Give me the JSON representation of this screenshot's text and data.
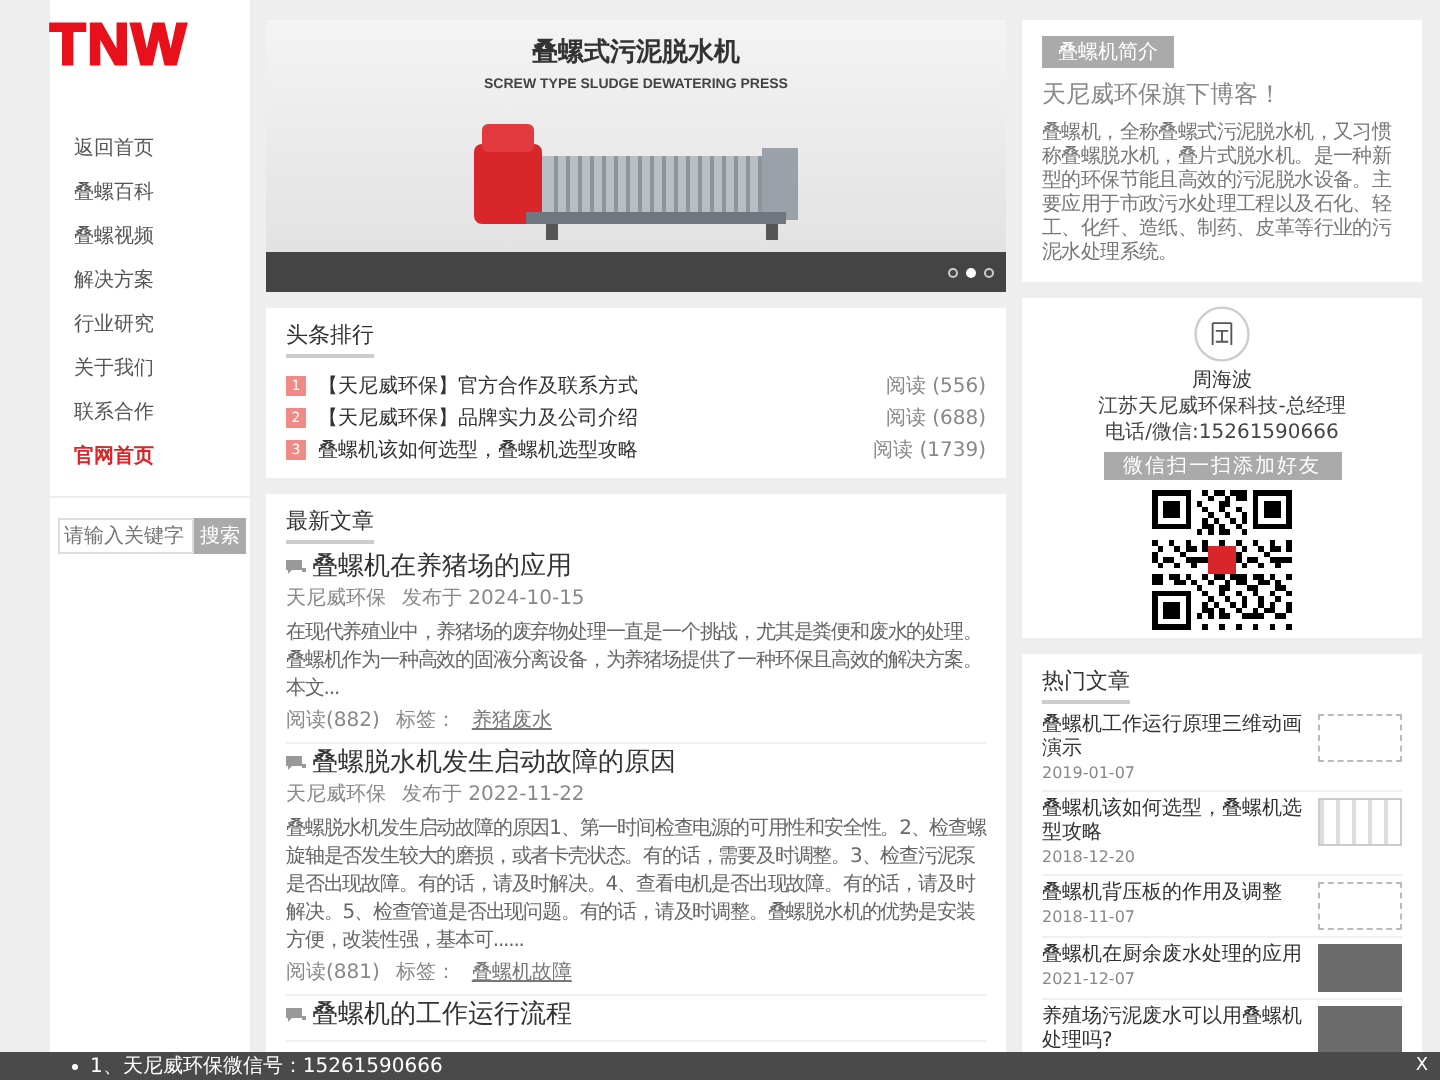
{
  "logo": "TNW",
  "nav": [
    {
      "label": "返回首页",
      "emphasized": false
    },
    {
      "label": "叠螺百科",
      "emphasized": false
    },
    {
      "label": "叠螺视频",
      "emphasized": false
    },
    {
      "label": "解决方案",
      "emphasized": false
    },
    {
      "label": "行业研究",
      "emphasized": false
    },
    {
      "label": "关于我们",
      "emphasized": false
    },
    {
      "label": "联系合作",
      "emphasized": false
    },
    {
      "label": "官网首页",
      "emphasized": true
    }
  ],
  "search": {
    "placeholder": "请输入关键字",
    "button": "搜索"
  },
  "banner": {
    "title": "叠螺式污泥脱水机",
    "subtitle": "SCREW TYPE SLUDGE DEWATERING PRESS",
    "dots": [
      {
        "selected": false
      },
      {
        "selected": true
      },
      {
        "selected": false
      }
    ]
  },
  "ranking": {
    "heading": "头条排行",
    "items": [
      {
        "rank": "1",
        "title": "【天尼威环保】官方合作及联系方式",
        "reads": "阅读 (556)"
      },
      {
        "rank": "2",
        "title": "【天尼威环保】品牌实力及公司介绍",
        "reads": "阅读 (688)"
      },
      {
        "rank": "3",
        "title": "叠螺机该如何选型，叠螺机选型攻略",
        "reads": "阅读 (1739)"
      }
    ]
  },
  "latest": {
    "heading": "最新文章",
    "articles": [
      {
        "title": "叠螺机在养猪场的应用",
        "author": "天尼威环保",
        "date": "发布于 2024-10-15",
        "excerpt": "在现代养殖业中，养猪场的废弃物处理一直是一个挑战，尤其是粪便和废水的处理。叠螺机作为一种高效的固液分离设备，为养猪场提供了一种环保且高效的解决方案。本文...",
        "reads": "阅读(882)",
        "tag_label": "标签：",
        "tag": "养猪废水"
      },
      {
        "title": "叠螺脱水机发生启动故障的原因",
        "author": "天尼威环保",
        "date": "发布于 2022-11-22",
        "excerpt": "叠螺脱水机发生启动故障的原因1、第一时间检查电源的可用性和安全性。2、检查螺旋轴是否发生较大的磨损，或者卡壳状态。有的话，需要及时调整。3、检查污泥泵是否出现故障。有的话，请及时解决。4、查看电机是否出现故障。有的话，请及时解决。5、检查管道是否出现问题。有的话，请及时调整。叠螺脱水机的优势是安装方便，改装性强，基本可......",
        "reads": "阅读(881)",
        "tag_label": "标签：",
        "tag": "叠螺机故障"
      },
      {
        "title": "叠螺机的工作运行流程"
      }
    ]
  },
  "intro": {
    "badge": "叠螺机简介",
    "headline": "天尼威环保旗下博客！",
    "text": "叠螺机，全称叠螺式污泥脱水机，又习惯称叠螺脱水机，叠片式脱水机。是一种新型的环保节能且高效的污泥脱水设备。主要应用于市政污水处理工程以及石化、轻工、化纤、造纸、制药、皮革等行业的污泥水处理系统。"
  },
  "contact": {
    "name": "周海波",
    "company": "江苏天尼威环保科技-总经理",
    "phone": "电话/微信:15261590666",
    "qr_label": "微信扫一扫添加好友"
  },
  "hot": {
    "heading": "热门文章",
    "items": [
      {
        "title": "叠螺机工作运行原理三维动画演示",
        "date": "2019-01-07",
        "kind": "diagram"
      },
      {
        "title": "叠螺机该如何选型，叠螺机选型攻略",
        "date": "2018-12-20",
        "kind": "table"
      },
      {
        "title": "叠螺机背压板的作用及调整",
        "date": "2018-11-07",
        "kind": "diagram"
      },
      {
        "title": "叠螺机在厨余废水处理的应用",
        "date": "2021-12-07",
        "kind": "photo"
      },
      {
        "title": "养殖场污泥废水可以用叠螺机处理吗?",
        "kind": "photo"
      }
    ]
  },
  "notice": {
    "text": "1、天尼威环保微信号：15261590666",
    "close": "X"
  }
}
